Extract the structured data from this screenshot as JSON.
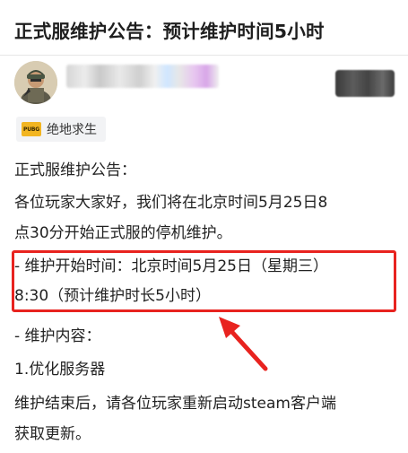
{
  "post": {
    "title": "正式服维护公告：预计维护时间5小时"
  },
  "author": {
    "avatar_icon": "player-avatar-icon",
    "name_blurred": true,
    "follow_blurred": true
  },
  "game_tag": {
    "logo_text": "PUBG",
    "label": "绝地求生"
  },
  "content": {
    "heading": "正式服维护公告：",
    "greeting_line1": "各位玩家大家好，我们将在北京时间5月25日8",
    "greeting_line2": "点30分开始正式服的停机维护。",
    "start_time_line1": "- 维护开始时间：北京时间5月25日（星期三）",
    "start_time_line2": "8:30（预计维护时长5小时）",
    "content_heading": "- 维护内容：",
    "item1": "1.优化服务器",
    "closing_line1": "维护结束后，请各位玩家重新启动steam客户端",
    "closing_line2": "获取更新。"
  },
  "annotation": {
    "box_color": "#e8231f",
    "arrow_color": "#e8231f"
  }
}
